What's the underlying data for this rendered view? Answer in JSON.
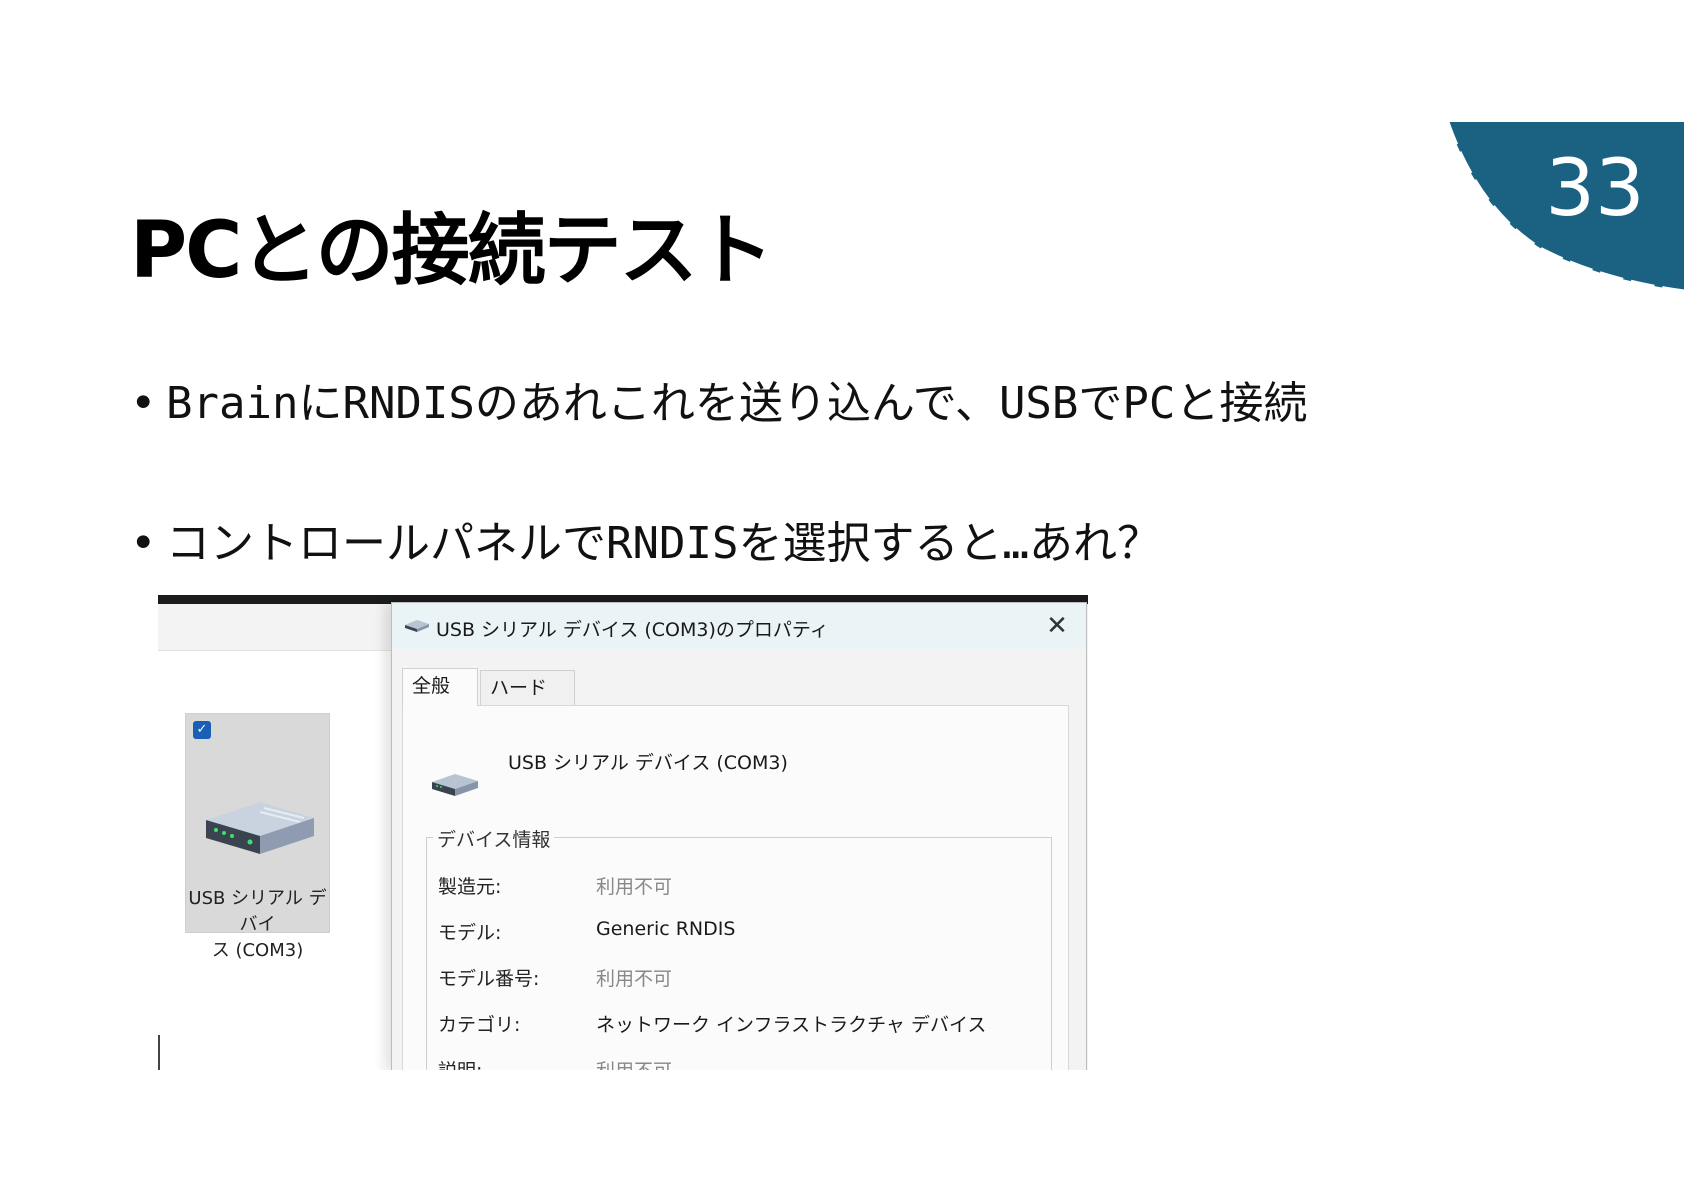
{
  "slide": {
    "page_number": "33",
    "title": "PCとの接続テスト",
    "bullets": [
      "BrainにRNDISのあれこれを送り込んで、USBでPCと接続",
      "コントロールパネルでRNDISを選択すると…あれ？"
    ],
    "accent_color": "#1b6282"
  },
  "explorer": {
    "device_tile": {
      "label_line1": "USB シリアル デバイ",
      "label_line2": "ス (COM3)",
      "checked": true,
      "icon": "usb-device-icon"
    }
  },
  "dialog": {
    "title": "USB シリアル デバイス (COM3)のプロパティ",
    "close_icon": "close-icon",
    "tabs": [
      {
        "label": "全般",
        "selected": true
      },
      {
        "label": "ハードウェア",
        "selected": false
      }
    ],
    "device_name": "USB シリアル デバイス (COM3)",
    "group_title": "デバイス情報",
    "rows": [
      {
        "label": "製造元:",
        "value": "利用不可"
      },
      {
        "label": "モデル:",
        "value": "Generic RNDIS"
      },
      {
        "label": "モデル番号:",
        "value": "利用不可"
      },
      {
        "label": "カテゴリ:",
        "value": "ネットワーク インフラストラクチャ デバイス"
      },
      {
        "label": "説明:",
        "value": "利用不可"
      }
    ]
  }
}
